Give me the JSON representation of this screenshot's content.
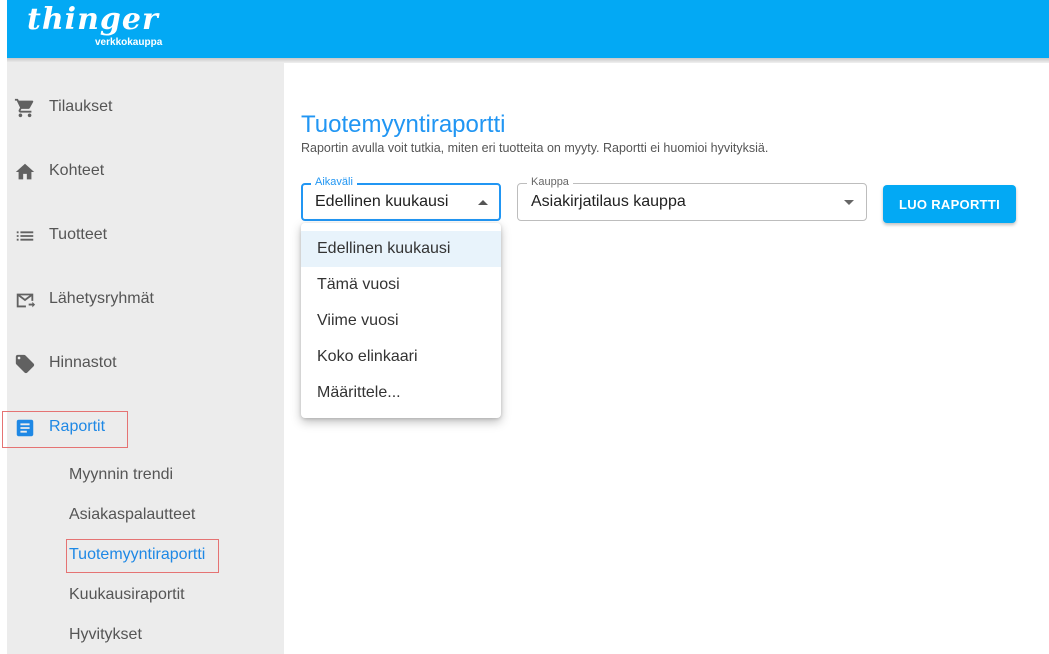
{
  "header": {
    "logo_main": "thinger",
    "logo_sub": "verkkokauppa",
    "color": "#03a9f4"
  },
  "sidebar": {
    "items": [
      {
        "label": "Tilaukset",
        "icon": "cart-icon"
      },
      {
        "label": "Kohteet",
        "icon": "home-icon"
      },
      {
        "label": "Tuotteet",
        "icon": "list-icon"
      },
      {
        "label": "Lähetysryhmät",
        "icon": "mail-forward-icon"
      },
      {
        "label": "Hinnastot",
        "icon": "tag-icon"
      },
      {
        "label": "Raportit",
        "icon": "report-icon",
        "active": true
      }
    ],
    "subitems": [
      {
        "label": "Myynnin trendi"
      },
      {
        "label": "Asiakaspalautteet"
      },
      {
        "label": "Tuotemyyntiraportti",
        "active": true
      },
      {
        "label": "Kuukausiraportit"
      },
      {
        "label": "Hyvitykset"
      }
    ]
  },
  "main": {
    "title": "Tuotemyyntiraportti",
    "description": "Raportin avulla voit tutkia, miten eri tuotteita on myyty. Raportti ei huomioi hyvityksiä.",
    "period_field": {
      "label": "Aikaväli",
      "value": "Edellinen kuukausi"
    },
    "store_field": {
      "label": "Kauppa",
      "value": "Asiakirjatilaus kauppa"
    },
    "create_button": "LUO RAPORTTI",
    "period_options": [
      {
        "label": "Edellinen kuukausi",
        "selected": true
      },
      {
        "label": "Tämä vuosi"
      },
      {
        "label": "Viime vuosi"
      },
      {
        "label": "Koko elinkaari"
      },
      {
        "label": "Määrittele..."
      }
    ]
  },
  "colors": {
    "accent": "#2196f3",
    "button": "#03a9f4",
    "highlight_border": "#e57373",
    "sidebar_bg": "#ececec"
  }
}
